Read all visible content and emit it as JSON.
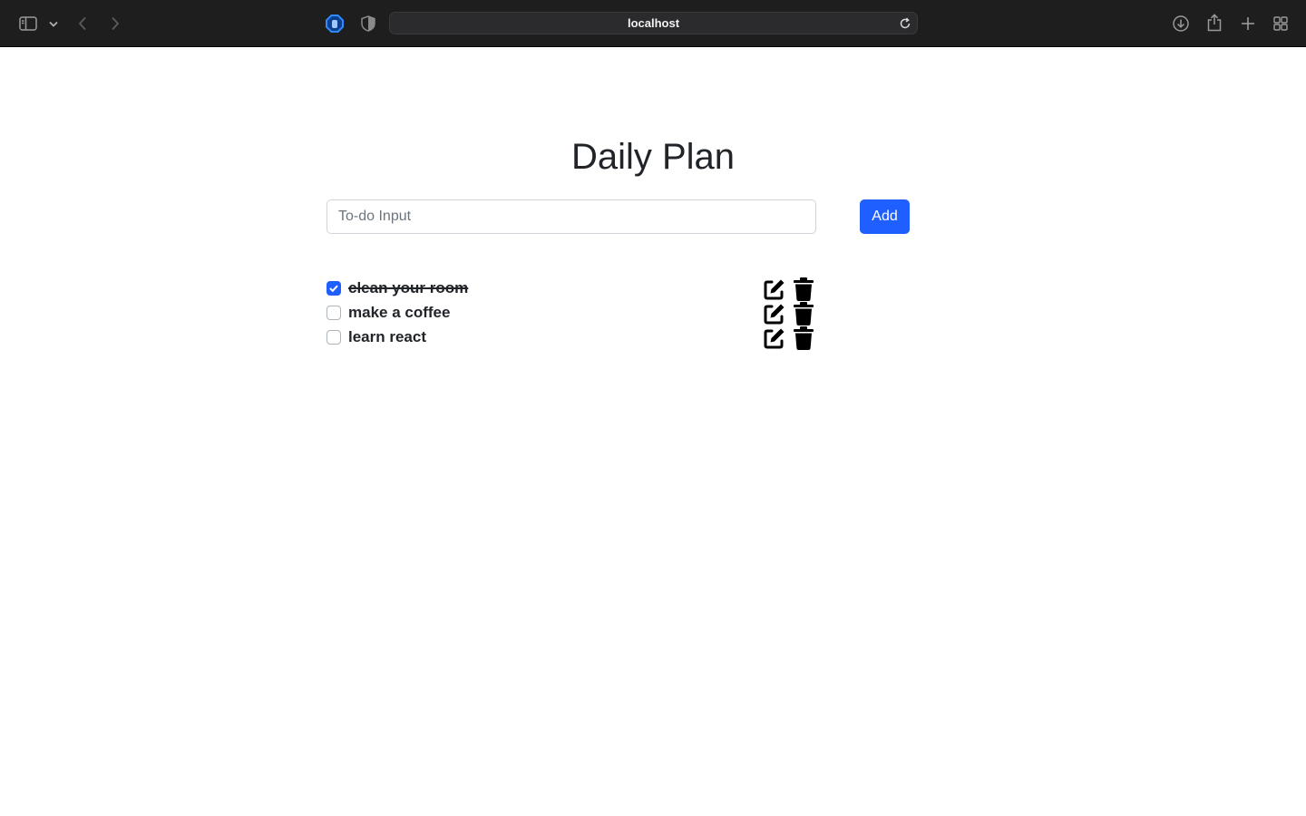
{
  "browser": {
    "address": "localhost",
    "icons": {
      "sidebar": "sidebar-toggle-icon",
      "sidebar_menu": "chevron-down-icon",
      "back": "back-arrow-icon",
      "forward": "forward-arrow-icon",
      "extension": "extension-hand-icon",
      "privacy": "privacy-shield-icon",
      "reload": "reload-icon",
      "downloads": "download-icon",
      "share": "share-icon",
      "new_tab": "plus-icon",
      "tab_overview": "tab-overview-icon"
    }
  },
  "app": {
    "title": "Daily Plan",
    "input": {
      "placeholder": "To-do Input",
      "value": ""
    },
    "add_label": "Add",
    "accent_color": "#1f5eff",
    "todos": [
      {
        "text": "clean your room",
        "done": true
      },
      {
        "text": "make a coffee",
        "done": false
      },
      {
        "text": "learn react",
        "done": false
      }
    ]
  }
}
